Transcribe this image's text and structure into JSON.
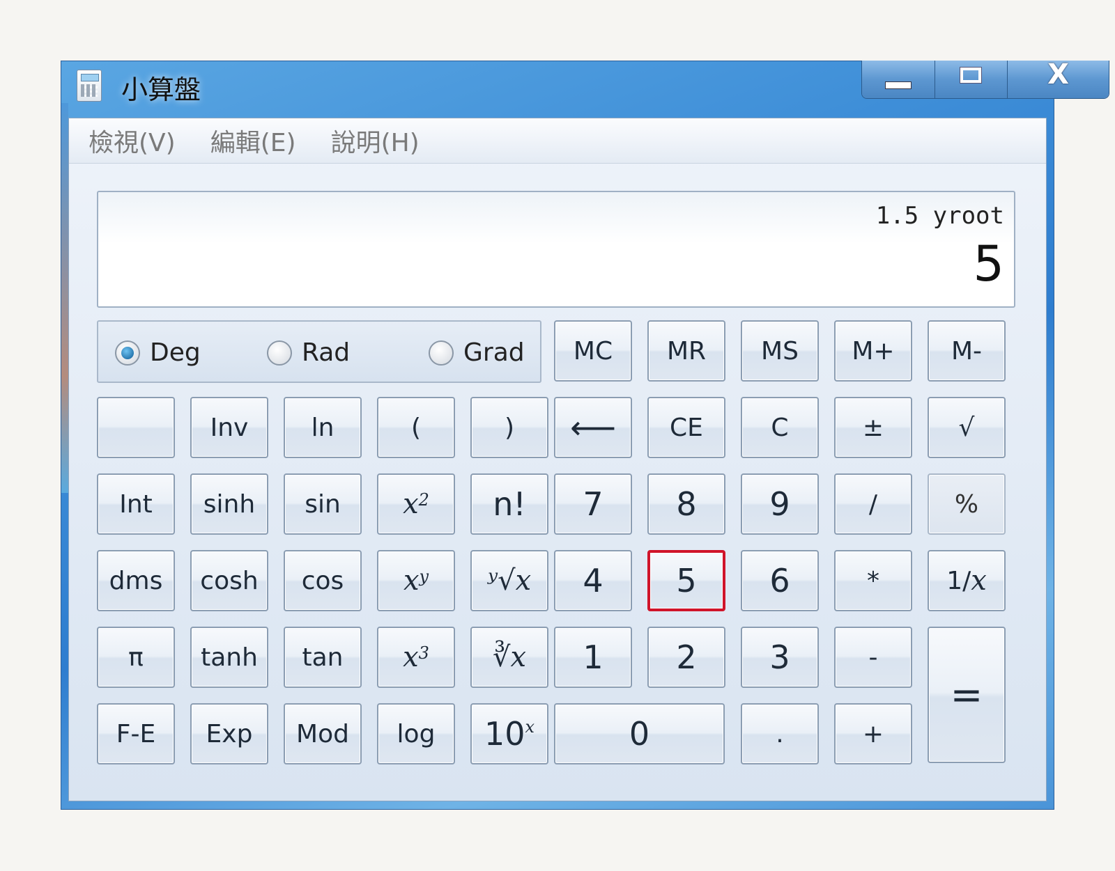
{
  "window": {
    "title": "小算盤",
    "icon": "calculator-icon",
    "caption": {
      "minimize": "minimize-icon",
      "maximize": "maximize-icon",
      "close": "X"
    }
  },
  "menu": [
    {
      "label": "檢視(V)"
    },
    {
      "label": "編輯(E)"
    },
    {
      "label": "說明(H)"
    }
  ],
  "display": {
    "expression": "1.5 yroot",
    "value": "5"
  },
  "angle_modes": [
    {
      "label": "Deg",
      "selected": true
    },
    {
      "label": "Rad",
      "selected": false
    },
    {
      "label": "Grad",
      "selected": false
    }
  ],
  "memory": [
    "MC",
    "MR",
    "MS",
    "M+",
    "M-"
  ],
  "rows": {
    "r1": [
      "",
      "Inv",
      "ln",
      "(",
      ")",
      "⟵",
      "CE",
      "C",
      "±",
      "√"
    ],
    "r2": [
      "Int",
      "sinh",
      "sin",
      "x²",
      "n!",
      "7",
      "8",
      "9",
      "/",
      "%"
    ],
    "r3": [
      "dms",
      "cosh",
      "cos",
      "xʸ",
      "ʸ√x",
      "4",
      "5",
      "6",
      "*",
      "1/x"
    ],
    "r4": [
      "π",
      "tanh",
      "tan",
      "x³",
      "∛x",
      "1",
      "2",
      "3",
      "-",
      "="
    ],
    "r5": [
      "F-E",
      "Exp",
      "Mod",
      "log",
      "10ˣ",
      "0",
      ".",
      "+"
    ]
  },
  "math_parts": {
    "x": "x",
    "sq": "2",
    "y": "y",
    "cube": "3",
    "root_y": "ʸ√",
    "root_3": "∛",
    "ten": "10",
    "one_over": "1/"
  },
  "highlight_color": "#d0142a",
  "focused_button": "5"
}
